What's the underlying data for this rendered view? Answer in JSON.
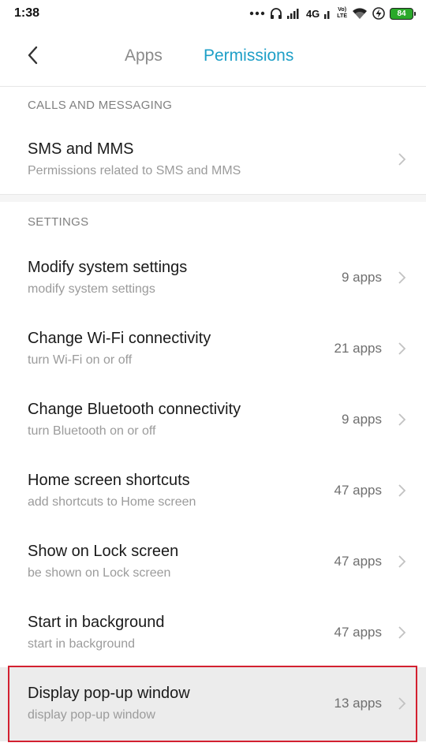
{
  "status_bar": {
    "time": "1:38",
    "network": "4G",
    "volte_top": "Vo)",
    "volte_bottom": "LTE",
    "battery": "84"
  },
  "header": {
    "tabs": [
      {
        "label": "Apps",
        "active": false
      },
      {
        "label": "Permissions",
        "active": true
      }
    ],
    "accent_color": "#1e9fc7"
  },
  "sections": [
    {
      "label": "CALLS AND MESSAGING",
      "items": [
        {
          "title": "SMS and MMS",
          "subtitle": "Permissions related to SMS and MMS",
          "count": ""
        }
      ]
    },
    {
      "label": "SETTINGS",
      "items": [
        {
          "title": "Modify system settings",
          "subtitle": "modify system settings",
          "count": "9 apps"
        },
        {
          "title": "Change Wi-Fi connectivity",
          "subtitle": "turn Wi-Fi on or off",
          "count": "21 apps"
        },
        {
          "title": "Change Bluetooth connectivity",
          "subtitle": "turn Bluetooth on or off",
          "count": "9 apps"
        },
        {
          "title": "Home screen shortcuts",
          "subtitle": "add shortcuts to Home screen",
          "count": "47 apps"
        },
        {
          "title": "Show on Lock screen",
          "subtitle": "be shown on Lock screen",
          "count": "47 apps"
        },
        {
          "title": "Start in background",
          "subtitle": "start in background",
          "count": "47 apps"
        },
        {
          "title": "Display pop-up window",
          "subtitle": "display pop-up window",
          "count": "13 apps",
          "highlighted": true
        }
      ]
    }
  ]
}
